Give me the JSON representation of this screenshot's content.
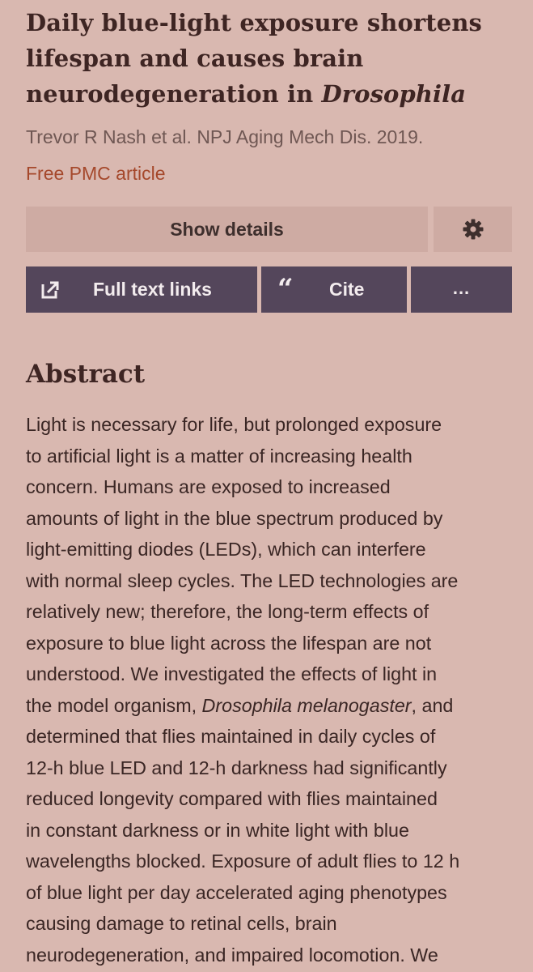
{
  "article": {
    "title_part1": "Daily blue-light exposure shortens lifespan and causes brain neurodegeneration in ",
    "title_italic": "Drosophila",
    "authors": "Trevor R Nash et al. NPJ Aging Mech Dis. 2019.",
    "free_pmc": "Free PMC article"
  },
  "buttons": {
    "show_details": "Show details",
    "settings_icon": "gear-icon",
    "full_text": "Full text links",
    "full_text_icon": "external-link-icon",
    "cite": "Cite",
    "cite_icon": "quote-icon",
    "more": "..."
  },
  "abstract": {
    "heading": "Abstract",
    "lines": [
      "Light is necessary for life, but prolonged exposure",
      "to artificial light is a matter of increasing health",
      "concern. Humans are exposed to increased",
      "amounts of light in the blue spectrum produced by",
      "light-emitting diodes (LEDs), which can interfere",
      "with normal sleep cycles. The LED technologies are",
      "relatively new; therefore, the long-term effects of",
      "exposure to blue light across the lifespan are not",
      "understood. We investigated the effects of light in",
      "the model organism, ",
      "Drosophila melanogaster",
      ", and",
      "determined that flies maintained in daily cycles of",
      "12-h blue LED and 12-h darkness had significantly",
      "reduced longevity compared with flies maintained",
      "in constant darkness or in white light with blue",
      "wavelengths blocked. Exposure of adult flies to 12 h",
      "of blue light per day accelerated aging phenotypes",
      "causing damage to retinal cells, brain",
      "neurodegeneration, and impaired locomotion. We"
    ]
  },
  "colors": {
    "background": "#d9b8b0",
    "button_primary": "#54465b",
    "button_secondary": "#ceaba3",
    "link": "#a5482b",
    "heading": "#3e2523"
  }
}
